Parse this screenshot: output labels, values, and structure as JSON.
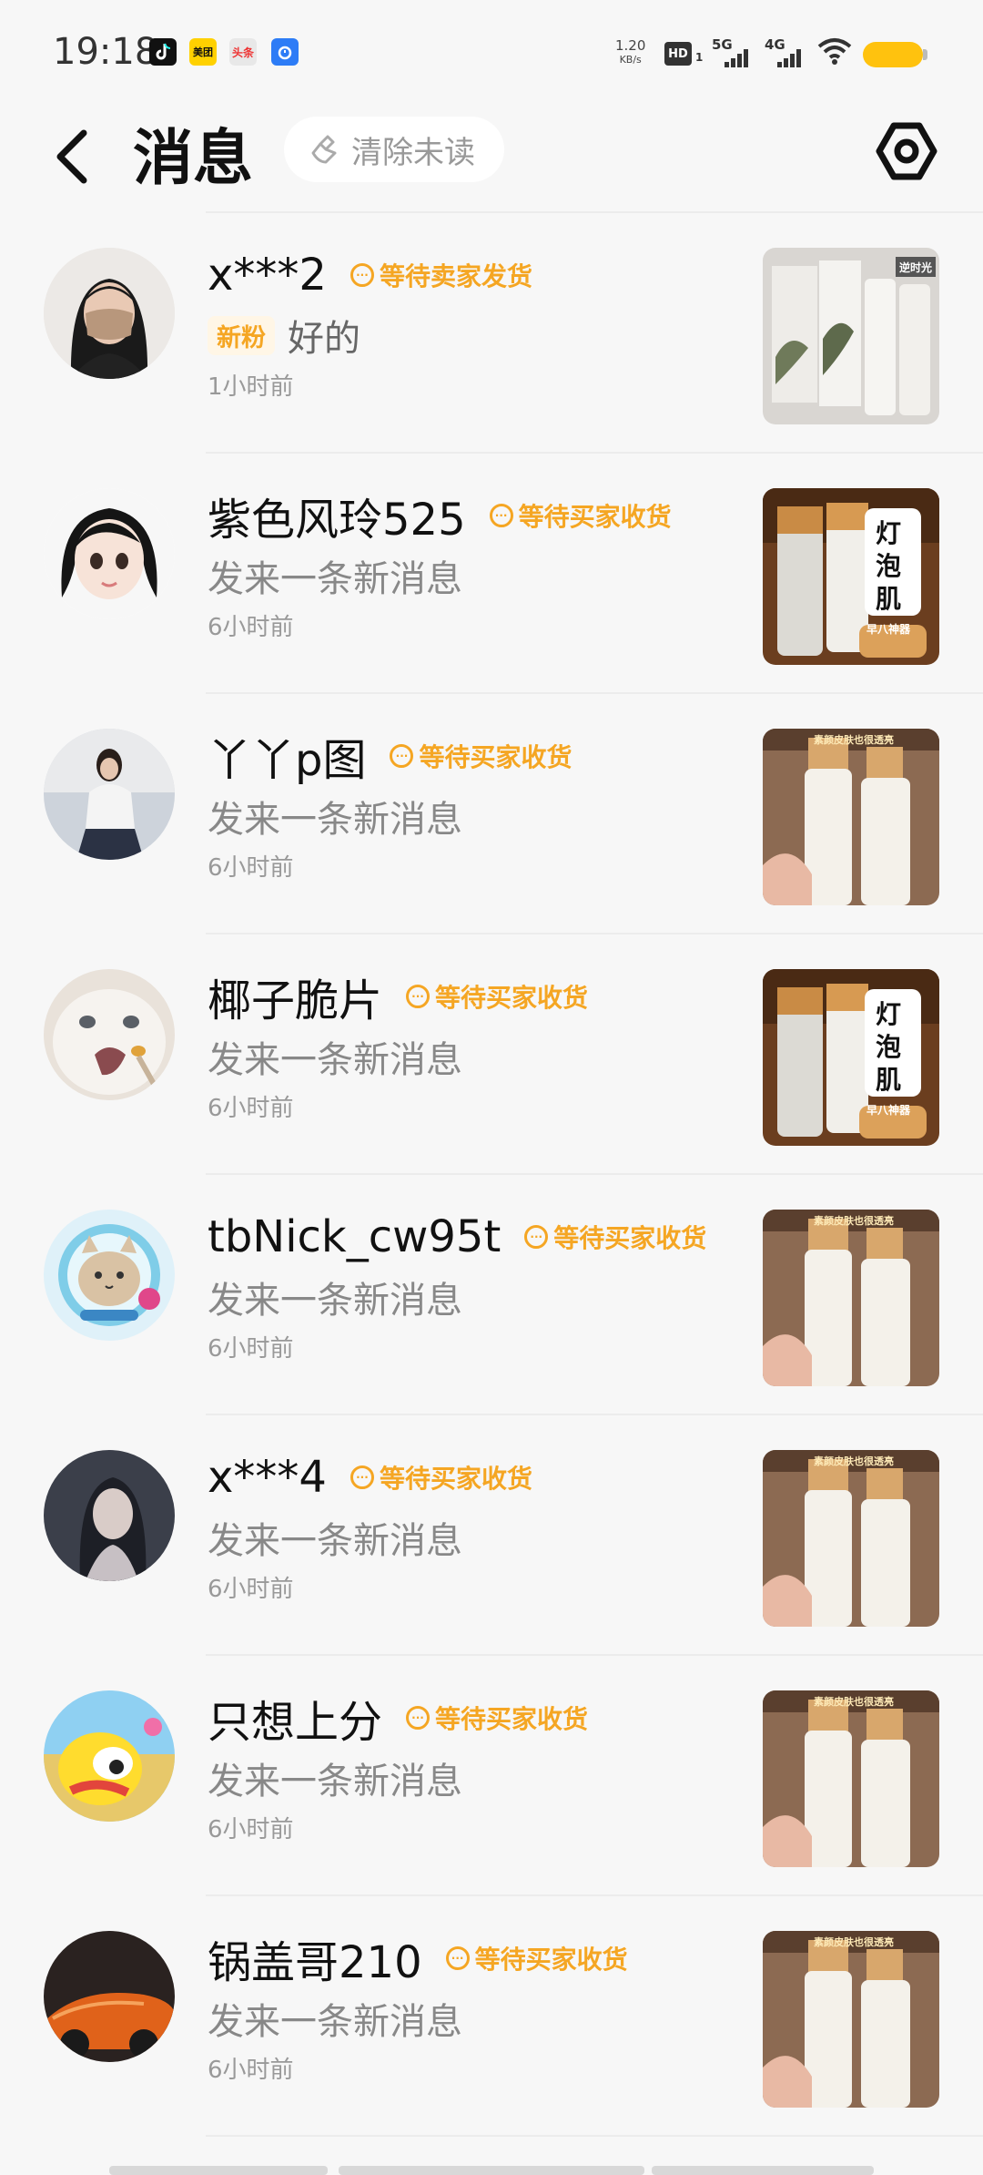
{
  "status_bar": {
    "time": "19:18",
    "app_icons": [
      "douyin-icon",
      "meituan-icon",
      "toutiao-icon",
      "alarm-icon"
    ],
    "app_icon_labels": [
      "",
      "美团",
      "头条",
      ""
    ],
    "net_speed_value": "1.20",
    "net_speed_unit": "KB/s",
    "hd_label": "HD",
    "hd_sub": "1",
    "sig1_label": "5G",
    "sig2_label": "4G"
  },
  "header": {
    "title": "消息",
    "clear_unread_label": "清除未读"
  },
  "accent_color": "#f5a623",
  "messages": [
    {
      "name": "x***2",
      "status": "等待卖家发货",
      "tag": "新粉",
      "message": "好的",
      "time": "1小时前"
    },
    {
      "name": "紫色风玲525",
      "status": "等待买家收货",
      "tag": "",
      "message": "发来一条新消息",
      "time": "6小时前"
    },
    {
      "name": "丫丫p图",
      "status": "等待买家收货",
      "tag": "",
      "message": "发来一条新消息",
      "time": "6小时前"
    },
    {
      "name": "椰子脆片",
      "status": "等待买家收货",
      "tag": "",
      "message": "发来一条新消息",
      "time": "6小时前"
    },
    {
      "name": "tbNick_cw95t",
      "status": "等待买家收货",
      "tag": "",
      "message": "发来一条新消息",
      "time": "6小时前"
    },
    {
      "name": "x***4",
      "status": "等待买家收货",
      "tag": "",
      "message": "发来一条新消息",
      "time": "6小时前"
    },
    {
      "name": "只想上分",
      "status": "等待买家收货",
      "tag": "",
      "message": "发来一条新消息",
      "time": "6小时前"
    },
    {
      "name": "锅盖哥210",
      "status": "等待买家收货",
      "tag": "",
      "message": "发来一条新消息",
      "time": "6小时前"
    }
  ],
  "thumb_texts": {
    "t1": "逆时光",
    "t2": "灯泡肌",
    "t2_sub": "早八神器",
    "t3": "素颜皮肤也很透亮"
  }
}
